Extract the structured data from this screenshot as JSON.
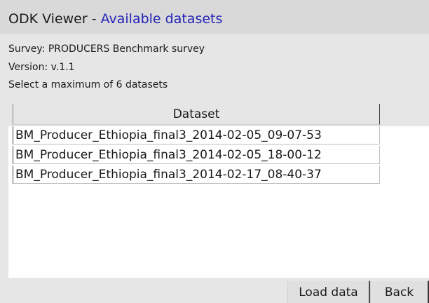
{
  "header": {
    "app_name": "ODK Viewer - ",
    "page_name": "Available datasets",
    "accent_color": "#2323b8"
  },
  "info": {
    "survey": "Survey: PRODUCERS Benchmark survey",
    "version": "Version: v.1.1",
    "instruction": "Select a maximum of 6 datasets"
  },
  "table": {
    "column_header": "Dataset",
    "rows": [
      "BM_Producer_Ethiopia_final3_2014-02-05_09-07-53",
      "BM_Producer_Ethiopia_final3_2014-02-05_18-00-12",
      "BM_Producer_Ethiopia_final3_2014-02-17_08-40-37"
    ]
  },
  "buttons": {
    "load_data": "Load data",
    "back": "Back"
  }
}
